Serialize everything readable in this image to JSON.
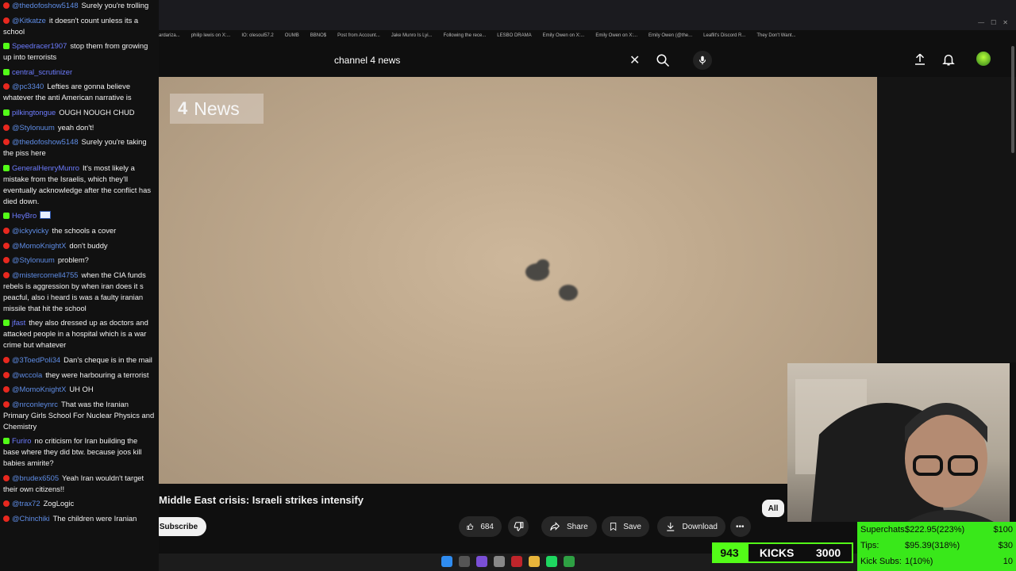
{
  "bookmarks": [
    "ardariza...",
    "philip lewis on X:...",
    "IO: olesoul57.2",
    "OUMB",
    "BBNO$",
    "Post from Account...",
    "Jake Munro Is Lyi...",
    "Following the rece...",
    "LESBO DRAMA",
    "Emily Owen on X:...",
    "Emily Owen on X:...",
    "Emily Owen (@the...",
    "Leaflit's Discord R...",
    "They Don't Want..."
  ],
  "search": {
    "query": "channel 4 news"
  },
  "video": {
    "logo_text": "News",
    "logo_glyph": "4",
    "title": "Middle East crisis: Israeli strikes intensify",
    "title_prefix_ghost": "Middle E"
  },
  "actions": {
    "subscribe": "Subscribe",
    "likes": "684",
    "share": "Share",
    "save": "Save",
    "download": "Download",
    "chip_all": "All"
  },
  "overlay": {
    "kick_count": "943",
    "kick_label": "KICKS",
    "kick_goal": "3000",
    "stats": [
      {
        "k": "Superchats:",
        "v": "$222.95(223%)",
        "g": "$100"
      },
      {
        "k": "Tips:",
        "v": "$95.39(318%)",
        "g": "$30"
      },
      {
        "k": "Kick Subs:",
        "v": "1(10%)",
        "g": "10"
      }
    ]
  },
  "chat": [
    {
      "src": "yt",
      "user": "@thedofoshow5148",
      "text": "Surely you're trolling"
    },
    {
      "src": "yt",
      "user": "@Kitkatze",
      "text": "it doesn't count unless its a school"
    },
    {
      "src": "kick",
      "user": "Speedracer1907",
      "text": "stop them from growing up into terrorists"
    },
    {
      "src": "kick",
      "user": "central_scrutinizer",
      "text": ""
    },
    {
      "src": "yt",
      "user": "@pc3340",
      "text": "Lefties are gonna believe whatever the anti American narrative is"
    },
    {
      "src": "kick",
      "user": "pilkingtongue",
      "text": "OUGH NOUGH CHUD"
    },
    {
      "src": "yt",
      "user": "@Stylonuum",
      "text": "yeah don't!"
    },
    {
      "src": "yt",
      "user": "@thedofoshow5148",
      "text": "Surely you're taking the piss here"
    },
    {
      "src": "kick",
      "user": "GeneralHenryMunro",
      "text": "It's most likely a mistake from the Israelis, which they'll eventually acknowledge after the conflict has died down."
    },
    {
      "src": "kick",
      "user": "HeyBro",
      "text": "",
      "flag": true
    },
    {
      "src": "yt",
      "user": "@ickyvicky",
      "text": "the schools a cover"
    },
    {
      "src": "yt",
      "user": "@MomoKnightX",
      "text": "don't buddy"
    },
    {
      "src": "yt",
      "user": "@Stylonuum",
      "text": "problem?"
    },
    {
      "src": "yt",
      "user": "@mistercornell4755",
      "text": "when the CIA funds rebels is aggression by when iran does it s peacful, also i heard is was a faulty iranian missile that hit the school"
    },
    {
      "src": "kick",
      "user": "jfast",
      "text": "they also dressed up as doctors and attacked people in a hospital which is a war crime but whatever"
    },
    {
      "src": "yt",
      "user": "@3ToedPoli34",
      "text": "Dan's cheque is in the mail"
    },
    {
      "src": "yt",
      "user": "@wccola",
      "text": "they were harbouring a terrorist"
    },
    {
      "src": "yt",
      "user": "@MomoKnightX",
      "text": "UH OH"
    },
    {
      "src": "yt",
      "user": "@nrconleynrc",
      "text": "That was the Iranian Primary Girls School For Nuclear Physics and Chemistry"
    },
    {
      "src": "kick",
      "user": "Furiro",
      "text": "no criticism for Iran building the base where they did btw. because joos kill babies amirite?"
    },
    {
      "src": "yt",
      "user": "@brudex6505",
      "text": "Yeah Iran wouldn't target their own citizens!!"
    },
    {
      "src": "yt",
      "user": "@trax72",
      "text": "ZogLogic"
    },
    {
      "src": "yt",
      "user": "@Chinchiki",
      "text": "The children were Iranian"
    }
  ],
  "colors": {
    "kick_green": "#53fc18",
    "yt_red": "#e8281f",
    "stats_green": "#39e81a"
  }
}
